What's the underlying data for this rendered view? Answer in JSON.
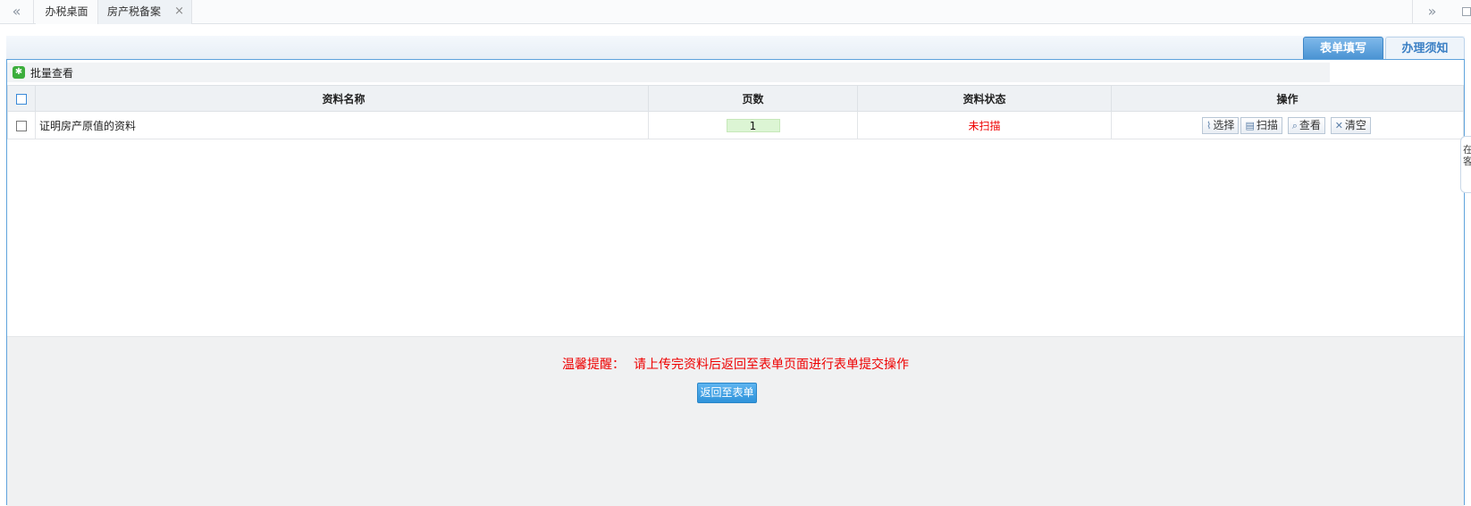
{
  "topbar": {
    "prev_glyph": "«",
    "next_glyph": "»",
    "tabs": [
      {
        "label": "办税桌面"
      },
      {
        "label": "房产税备案",
        "close_glyph": "×"
      }
    ]
  },
  "form_tabs": [
    {
      "label": "表单填写",
      "active": true
    },
    {
      "label": "办理须知",
      "active": false
    }
  ],
  "toolbar": {
    "batch_icon_glyph": "✱",
    "batch_view_label": "批量查看"
  },
  "table": {
    "headers": [
      "资料名称",
      "页数",
      "资料状态",
      "操作"
    ],
    "rows": [
      {
        "name": "证明房产原值的资料",
        "pages": "1",
        "status": "未扫描",
        "actions": {
          "select": "选择",
          "scan": "扫描",
          "view": "查看",
          "clear": "清空"
        }
      }
    ]
  },
  "side_handle": {
    "text": "在\n客"
  },
  "footer": {
    "tip_prefix": "温馨提醒：",
    "tip_text": "请上传完资料后返回至表单页面进行表单提交操作",
    "return_button": "返回至表单"
  },
  "colors": {
    "accent": "#4a93d3",
    "status_red": "#e00000",
    "page_badge_bg": "#dcf5d4"
  }
}
